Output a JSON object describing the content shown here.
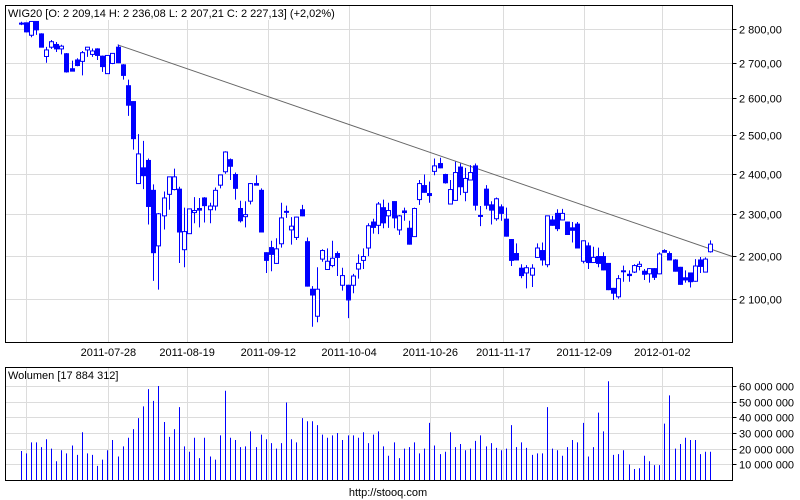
{
  "header": {
    "title": "WIG20 [O: 2 209,14  H: 2 236,08  L: 2 207,21  C: 2 227,13] (+2,02%)",
    "volume_title": "Wolumen [17 884 312]",
    "footer": "http://stooq.com"
  },
  "colors": {
    "candle": "#0000ff",
    "grid": "#dcdcdc",
    "trendline": "#666666",
    "volume": "#0000ff"
  },
  "chart_data": [
    {
      "type": "candlestick",
      "title": "WIG20",
      "scale": "log",
      "ylim": [
        2010,
        2840
      ],
      "y_ticks": [
        2800,
        2700,
        2600,
        2500,
        2400,
        2300,
        2200,
        2100
      ],
      "y_tick_labels": [
        "2 800,00",
        "2 700,00",
        "2 600,00",
        "2 500,00",
        "2 400,00",
        "2 300,00",
        "2 200,00",
        "2 100,00"
      ],
      "x_ticks": [
        {
          "index": 17.2,
          "label": "2011-07-28"
        },
        {
          "index": 32.6,
          "label": "2011-08-19"
        },
        {
          "index": 48.5,
          "label": "2011-09-12"
        },
        {
          "index": 64.3,
          "label": "2011-10-04"
        },
        {
          "index": 80.2,
          "label": "2011-10-26"
        },
        {
          "index": 94.5,
          "label": "2011-11-17"
        },
        {
          "index": 110.3,
          "label": "2011-12-09"
        },
        {
          "index": 125.6,
          "label": "2012-01-02"
        }
      ],
      "x_grid_extra": [
        1.1
      ],
      "trendline": {
        "from": {
          "index": 19,
          "price": 2752
        },
        "to": {
          "index": 139.3,
          "price": 2198
        }
      },
      "ohlc": [
        [
          2815,
          2820,
          2810,
          2816
        ],
        [
          2817,
          2818,
          2788,
          2790
        ],
        [
          2780,
          2822,
          2774,
          2821
        ],
        [
          2821,
          2822,
          2781,
          2796
        ],
        [
          2784,
          2786,
          2744,
          2745
        ],
        [
          2718,
          2746,
          2700,
          2737
        ],
        [
          2745,
          2766,
          2740,
          2761
        ],
        [
          2753,
          2760,
          2731,
          2740
        ],
        [
          2740,
          2752,
          2724,
          2748
        ],
        [
          2726,
          2728,
          2672,
          2674
        ],
        [
          2683,
          2706,
          2675,
          2676
        ],
        [
          2708,
          2713,
          2690,
          2692
        ],
        [
          2704,
          2734,
          2664,
          2729
        ],
        [
          2737,
          2746,
          2717,
          2745
        ],
        [
          2724,
          2741,
          2717,
          2734
        ],
        [
          2740,
          2742,
          2708,
          2721
        ],
        [
          2719,
          2721,
          2674,
          2689
        ],
        [
          2669,
          2722,
          2668,
          2721
        ],
        [
          2698,
          2728,
          2696,
          2727
        ],
        [
          2745,
          2753,
          2699,
          2700
        ],
        [
          2694,
          2696,
          2652,
          2664
        ],
        [
          2635,
          2652,
          2552,
          2581
        ],
        [
          2591,
          2592,
          2462,
          2491
        ],
        [
          2375,
          2503,
          2375,
          2451
        ],
        [
          2415,
          2485,
          2361,
          2395
        ],
        [
          2434,
          2439,
          2274,
          2318
        ],
        [
          2358,
          2373,
          2142,
          2207
        ],
        [
          2223,
          2302,
          2122,
          2300
        ],
        [
          2295,
          2355,
          2262,
          2339
        ],
        [
          2348,
          2393,
          2310,
          2392
        ],
        [
          2360,
          2413,
          2358,
          2392
        ],
        [
          2361,
          2367,
          2183,
          2256
        ],
        [
          2214,
          2315,
          2173,
          2257
        ],
        [
          2252,
          2312,
          2252,
          2312
        ],
        [
          2303,
          2341,
          2277,
          2308
        ],
        [
          2313,
          2339,
          2267,
          2309
        ],
        [
          2339,
          2341,
          2279,
          2320
        ],
        [
          2310,
          2327,
          2277,
          2319
        ],
        [
          2319,
          2365,
          2308,
          2358
        ],
        [
          2371,
          2398,
          2363,
          2397
        ],
        [
          2405,
          2458,
          2400,
          2456
        ],
        [
          2436,
          2439,
          2384,
          2419
        ],
        [
          2398,
          2403,
          2335,
          2363
        ],
        [
          2313,
          2332,
          2279,
          2283
        ],
        [
          2293,
          2331,
          2267,
          2298
        ],
        [
          2331,
          2376,
          2323,
          2375
        ],
        [
          2375,
          2396,
          2370,
          2371
        ],
        [
          2358,
          2363,
          2255,
          2256
        ],
        [
          2207,
          2208,
          2160,
          2189
        ],
        [
          2219,
          2235,
          2164,
          2203
        ],
        [
          2182,
          2241,
          2181,
          2216
        ],
        [
          2228,
          2327,
          2219,
          2290
        ],
        [
          2306,
          2320,
          2290,
          2305
        ],
        [
          2261,
          2292,
          2226,
          2270
        ],
        [
          2243,
          2293,
          2237,
          2292
        ],
        [
          2310,
          2322,
          2294,
          2295
        ],
        [
          2233,
          2243,
          2129,
          2130
        ],
        [
          2123,
          2130,
          2040,
          2110
        ],
        [
          2063,
          2173,
          2050,
          2123
        ],
        [
          2192,
          2215,
          2186,
          2212
        ],
        [
          2168,
          2217,
          2167,
          2187
        ],
        [
          2177,
          2235,
          2173,
          2194
        ],
        [
          2205,
          2210,
          2153,
          2196
        ],
        [
          2132,
          2172,
          2120,
          2154
        ],
        [
          2132,
          2133,
          2059,
          2099
        ],
        [
          2132,
          2158,
          2114,
          2153
        ],
        [
          2169,
          2203,
          2147,
          2182
        ],
        [
          2189,
          2217,
          2169,
          2198
        ],
        [
          2218,
          2277,
          2199,
          2271
        ],
        [
          2280,
          2288,
          2252,
          2267
        ],
        [
          2272,
          2329,
          2251,
          2324
        ],
        [
          2315,
          2335,
          2265,
          2278
        ],
        [
          2295,
          2327,
          2266,
          2308
        ],
        [
          2330,
          2331,
          2265,
          2290
        ],
        [
          2261,
          2297,
          2249,
          2295
        ],
        [
          2307,
          2315,
          2283,
          2303
        ],
        [
          2265,
          2283,
          2226,
          2227
        ],
        [
          2245,
          2315,
          2244,
          2313
        ],
        [
          2335,
          2384,
          2322,
          2375
        ],
        [
          2370,
          2398,
          2352,
          2353
        ],
        [
          2350,
          2380,
          2327,
          2345
        ],
        [
          2406,
          2439,
          2396,
          2420
        ],
        [
          2426,
          2441,
          2414,
          2415
        ],
        [
          2398,
          2400,
          2375,
          2377
        ],
        [
          2324,
          2384,
          2323,
          2360
        ],
        [
          2333,
          2431,
          2332,
          2403
        ],
        [
          2417,
          2426,
          2346,
          2367
        ],
        [
          2353,
          2415,
          2331,
          2388
        ],
        [
          2384,
          2422,
          2383,
          2403
        ],
        [
          2420,
          2426,
          2308,
          2321
        ],
        [
          2295,
          2319,
          2270,
          2296
        ],
        [
          2361,
          2371,
          2311,
          2321
        ],
        [
          2322,
          2331,
          2274,
          2309
        ],
        [
          2288,
          2340,
          2283,
          2337
        ],
        [
          2317,
          2323,
          2283,
          2301
        ],
        [
          2287,
          2315,
          2245,
          2246
        ],
        [
          2238,
          2239,
          2176,
          2189
        ],
        [
          2205,
          2229,
          2189,
          2190
        ],
        [
          2171,
          2180,
          2148,
          2154
        ],
        [
          2160,
          2178,
          2125,
          2172
        ],
        [
          2155,
          2180,
          2128,
          2171
        ],
        [
          2196,
          2229,
          2195,
          2218
        ],
        [
          2212,
          2231,
          2177,
          2190
        ],
        [
          2179,
          2296,
          2173,
          2295
        ],
        [
          2285,
          2295,
          2271,
          2272
        ],
        [
          2301,
          2311,
          2258,
          2264
        ],
        [
          2285,
          2312,
          2284,
          2301
        ],
        [
          2280,
          2281,
          2249,
          2250
        ],
        [
          2266,
          2280,
          2231,
          2260
        ],
        [
          2275,
          2280,
          2217,
          2218
        ],
        [
          2187,
          2236,
          2182,
          2235
        ],
        [
          2223,
          2231,
          2169,
          2184
        ],
        [
          2184,
          2221,
          2183,
          2196
        ],
        [
          2198,
          2219,
          2173,
          2182
        ],
        [
          2198,
          2208,
          2166,
          2167
        ],
        [
          2182,
          2183,
          2121,
          2122
        ],
        [
          2125,
          2126,
          2099,
          2114
        ],
        [
          2106,
          2155,
          2102,
          2147
        ],
        [
          2164,
          2177,
          2140,
          2165
        ],
        [
          2157,
          2166,
          2140,
          2154
        ],
        [
          2162,
          2180,
          2160,
          2177
        ],
        [
          2175,
          2187,
          2166,
          2180
        ],
        [
          2164,
          2169,
          2144,
          2157
        ],
        [
          2158,
          2171,
          2138,
          2170
        ],
        [
          2170,
          2171,
          2144,
          2150
        ],
        [
          2158,
          2208,
          2157,
          2204
        ],
        [
          2212,
          2215,
          2207,
          2208
        ],
        [
          2205,
          2210,
          2189,
          2190
        ],
        [
          2190,
          2192,
          2163,
          2164
        ],
        [
          2173,
          2174,
          2133,
          2134
        ],
        [
          2149,
          2166,
          2138,
          2144
        ],
        [
          2160,
          2161,
          2127,
          2140
        ],
        [
          2141,
          2192,
          2140,
          2176
        ],
        [
          2190,
          2197,
          2160,
          2175
        ],
        [
          2162,
          2196,
          2161,
          2192
        ],
        [
          2209.14,
          2236.08,
          2207.21,
          2227.13
        ]
      ]
    },
    {
      "type": "bar",
      "title": "Wolumen",
      "unit": "millions",
      "ylim": [
        0,
        66
      ],
      "y_ticks": [
        10,
        20,
        30,
        40,
        50,
        60
      ],
      "y_tick_labels": [
        "10 000 000",
        "20 000 000",
        "30 000 000",
        "40 000 000",
        "50 000 000",
        "60 000 000"
      ],
      "values": [
        18.5,
        17,
        24,
        24,
        21,
        26,
        20,
        12,
        19,
        17,
        22,
        16,
        30.5,
        17,
        16,
        9,
        13,
        19,
        25.5,
        15,
        21.5,
        27,
        32.5,
        39.5,
        47,
        58,
        50.5,
        60,
        37,
        27.5,
        32.5,
        46.5,
        21.5,
        18,
        27,
        14,
        27,
        15,
        13,
        28.5,
        57,
        27,
        25.5,
        21,
        21.5,
        31,
        21,
        29,
        26,
        23.5,
        20,
        23.5,
        49.5,
        26,
        24,
        39.5,
        37.5,
        37.5,
        35,
        29,
        27,
        28.5,
        30,
        25.5,
        28.5,
        28.5,
        27,
        30.5,
        23.5,
        29,
        31,
        21.5,
        15.5,
        24,
        14,
        20,
        21,
        24,
        17,
        20,
        36.5,
        22,
        16.5,
        18,
        30.5,
        21,
        23,
        19,
        20,
        25,
        28.5,
        21.5,
        23.5,
        20.5,
        19,
        20,
        35,
        21,
        24,
        20.5,
        16,
        17,
        17,
        46.5,
        20,
        19,
        15.5,
        21,
        25.5,
        24,
        36.5,
        15,
        21,
        43,
        31,
        63,
        16,
        16.5,
        19,
        10,
        7,
        7.5,
        15.5,
        12,
        9.5,
        9.5,
        36,
        54,
        20,
        23,
        27,
        25.5,
        25.5,
        16.5,
        18,
        18
      ]
    }
  ]
}
